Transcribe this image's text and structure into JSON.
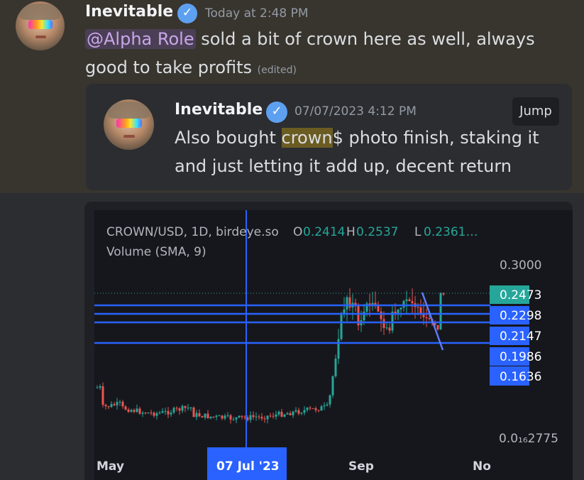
{
  "message": {
    "author": "Inevitable",
    "verified_icon": "verified-badge-icon",
    "timestamp": "Today at 2:48 PM",
    "mention": "@Alpha Role",
    "text_line1": "sold a bit of crown here as well, always",
    "text_line2": "good to take profits",
    "edited_label": "(edited)"
  },
  "reply": {
    "author": "Inevitable",
    "timestamp": "07/07/2023 4:12 PM",
    "jump_label": "Jump",
    "text_line1_before": "Also bought ",
    "text_line1_highlight": "crown",
    "text_line1_after": "$ photo finish, staking it",
    "text_line2": "and just letting it add up, decent return"
  },
  "chart": {
    "symbol_line": "CROWN/USD, 1D, birdeye.so",
    "o_label": "O",
    "o_value": "0.2414",
    "h_label": "H",
    "h_value": "0.2537",
    "l_label": "L",
    "l_value": "0.2361…",
    "volume_label": "Volume (SMA, 9)",
    "price_axis": [
      "0.3000",
      "0.2473",
      "0.2298",
      "0.2147",
      "0.1986",
      "0.1636",
      "0.0₁₆2775"
    ],
    "time_axis": [
      "May",
      "07 Jul '23",
      "Sep",
      "No"
    ],
    "current_price": "0.2473",
    "colors": {
      "up": "#26a69a",
      "down": "#ef5350",
      "line": "#2962ff",
      "label_blue": "#2962ff",
      "label_green": "#26a69a"
    }
  }
}
